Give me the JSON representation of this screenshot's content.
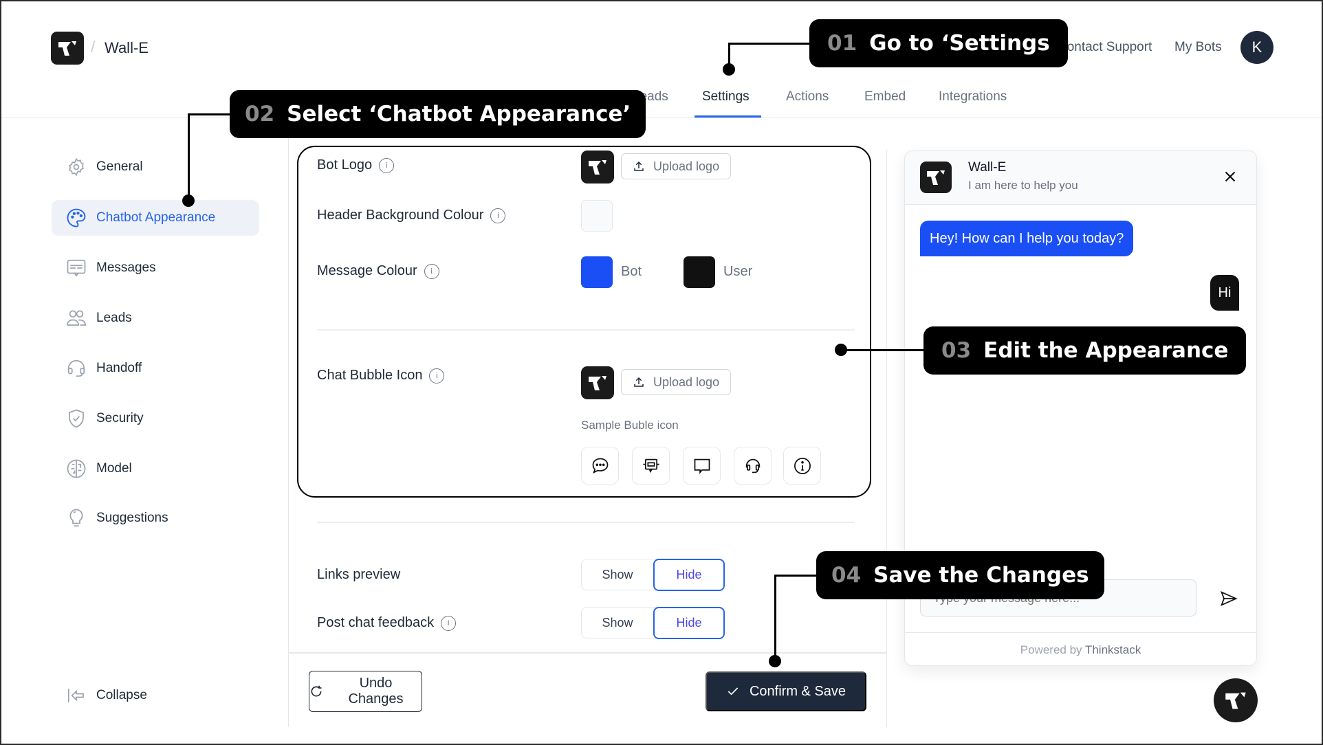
{
  "brand": {
    "logo_icon": "thinkstack-logo-icon",
    "separator": "/",
    "bot_name": "Wall-E"
  },
  "nav": {
    "tabs": [
      {
        "label": "Leads",
        "active": false
      },
      {
        "label": "Settings",
        "active": true
      },
      {
        "label": "Actions",
        "active": false
      },
      {
        "label": "Embed",
        "active": false
      },
      {
        "label": "Integrations",
        "active": false
      }
    ],
    "links": {
      "contact_support": "Contact Support",
      "my_bots": "My Bots"
    },
    "avatar_initial": "K"
  },
  "sidebar": {
    "items": [
      {
        "label": "General",
        "icon": "gear-icon",
        "active": false
      },
      {
        "label": "Chatbot Appearance",
        "icon": "palette-icon",
        "active": true
      },
      {
        "label": "Messages",
        "icon": "message-icon",
        "active": false
      },
      {
        "label": "Leads",
        "icon": "users-icon",
        "active": false
      },
      {
        "label": "Handoff",
        "icon": "headset-icon",
        "active": false
      },
      {
        "label": "Security",
        "icon": "shield-check-icon",
        "active": false
      },
      {
        "label": "Model",
        "icon": "brain-icon",
        "active": false
      },
      {
        "label": "Suggestions",
        "icon": "lightbulb-icon",
        "active": false
      }
    ],
    "collapse_label": "Collapse"
  },
  "form": {
    "bot_logo": {
      "label": "Bot Logo",
      "upload_label": "Upload logo"
    },
    "header_bg": {
      "label": "Header Background Colour",
      "value": "#F9FAFC"
    },
    "message_colour": {
      "label": "Message Colour",
      "bot_label": "Bot",
      "bot_color": "#1A4FF5",
      "user_label": "User",
      "user_color": "#111111"
    },
    "chat_bubble_icon": {
      "label": "Chat Bubble Icon",
      "upload_label": "Upload logo",
      "sample_label": "Sample Buble icon",
      "samples": [
        "chat-dots-icon",
        "robot-icon",
        "speech-bubble-icon",
        "headset-icon",
        "info-icon"
      ]
    },
    "links_preview": {
      "label": "Links preview",
      "options": [
        "Show",
        "Hide"
      ],
      "selected": "Hide"
    },
    "post_chat_feedback": {
      "label": "Post chat feedback",
      "options": [
        "Show",
        "Hide"
      ],
      "selected": "Hide"
    },
    "undo_label": "Undo Changes",
    "save_label": "Confirm & Save",
    "info_glyph": "i"
  },
  "preview": {
    "title": "Wall-E",
    "subtitle": "I am here to help you",
    "bot_message": "Hey! How can I help you today?",
    "user_message": "Hi",
    "input_placeholder": "Type your message here...",
    "powered_prefix": "Powered by ",
    "powered_brand": "Thinkstack"
  },
  "callouts": [
    {
      "num": "01",
      "text": "Go to ‘Settings"
    },
    {
      "num": "02",
      "text": "Select ‘Chatbot Appearance’"
    },
    {
      "num": "03",
      "text": "Edit the Appearance"
    },
    {
      "num": "04",
      "text": "Save the Changes"
    }
  ]
}
